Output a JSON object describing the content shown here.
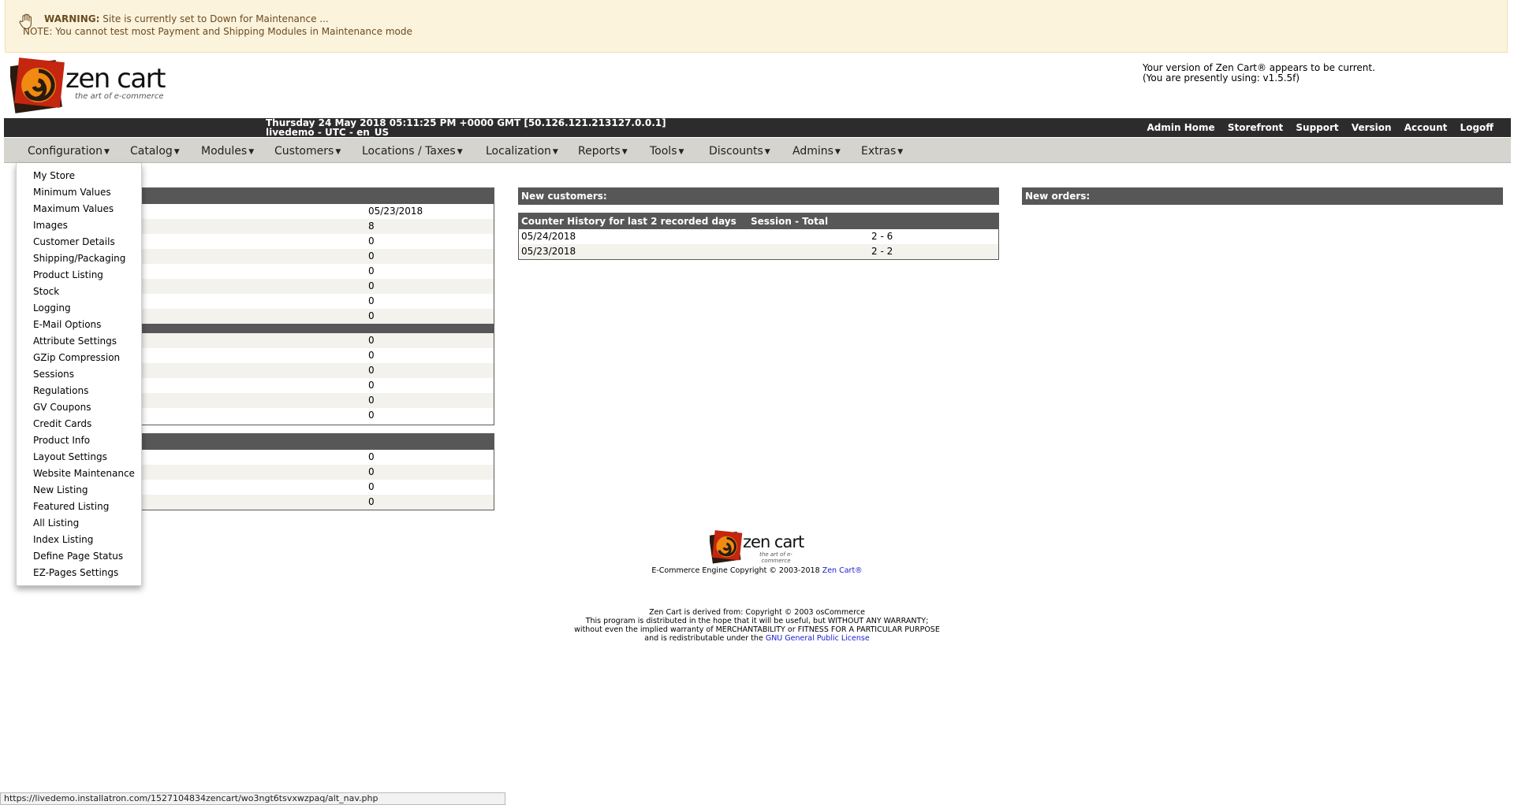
{
  "warning": {
    "label": "WARNING:",
    "text": "Site is currently set to Down for Maintenance ...",
    "note": "NOTE: You cannot test most Payment and Shipping Modules in Maintenance mode"
  },
  "logo": {
    "name": "zen cart",
    "tagline": "the art of e-commerce"
  },
  "version_info": {
    "line1": "Your version of Zen Cart® appears to be current.",
    "line2": "(You are presently using: v1.5.5f)"
  },
  "topbar": {
    "datetime": "Thursday 24 May 2018 05:11:25 PM +0000 GMT [50.126.121.213127.0.0.1]",
    "store_locale": "livedemo - UTC - en_US",
    "links": [
      "Admin Home",
      "Storefront",
      "Support",
      "Version",
      "Account",
      "Logoff"
    ]
  },
  "menu": {
    "items": [
      "Configuration",
      "Catalog",
      "Modules",
      "Customers",
      "Locations / Taxes",
      "Localization",
      "Reports",
      "Tools",
      "Discounts",
      "Admins",
      "Extras"
    ]
  },
  "dropdown": {
    "items": [
      "My Store",
      "Minimum Values",
      "Maximum Values",
      "Images",
      "Customer Details",
      "Shipping/Packaging",
      "Product Listing",
      "Stock",
      "Logging",
      "E-Mail Options",
      "Attribute Settings",
      "GZip Compression",
      "Sessions",
      "Regulations",
      "GV Coupons",
      "Credit Cards",
      "Product Info",
      "Layout Settings",
      "Website Maintenance",
      "New Listing",
      "Featured Listing",
      "All Listing",
      "Index Listing",
      "Define Page Status",
      "EZ-Pages Settings"
    ]
  },
  "stats_panel1": {
    "values": [
      "05/23/2018",
      "8",
      "0",
      "0",
      "0",
      "0",
      "0",
      "0"
    ]
  },
  "stats_panel2": {
    "values": [
      "0",
      "0",
      "0",
      "0",
      "0",
      "0"
    ]
  },
  "stats_panel3": {
    "values": [
      "0",
      "0",
      "0",
      "0"
    ]
  },
  "new_customers": {
    "title": "New customers:"
  },
  "counter_history": {
    "title": "Counter History for last 2 recorded days",
    "col2": "Session - Total",
    "rows": [
      {
        "date": "05/24/2018",
        "value": "2 - 6"
      },
      {
        "date": "05/23/2018",
        "value": "2 - 2"
      }
    ]
  },
  "new_orders": {
    "title": "New orders:"
  },
  "footer": {
    "copyright": "E-Commerce Engine Copyright © 2003-2018",
    "link": "Zen Cart®",
    "license_line1": "Zen Cart is derived from: Copyright © 2003 osCommerce",
    "license_line2": "This program is distributed in the hope that it will be useful, but WITHOUT ANY WARRANTY;",
    "license_line3": "without even the implied warranty of MERCHANTABILITY or FITNESS FOR A PARTICULAR PURPOSE",
    "license_line4": "and is redistributable under the",
    "license_link": "GNU General Public License"
  },
  "status_url": "https://livedemo.installatron.com/1527104834zencart/wo3ngt6tsvxwzpaq/alt_nav.php",
  "colors": {
    "warning_bg": "#fbf3dc",
    "topbar_bg": "#2c2c2c",
    "menubar_bg": "#d6d4ce",
    "panel_head_bg": "#575757",
    "link_blue": "#1a1ad6"
  }
}
